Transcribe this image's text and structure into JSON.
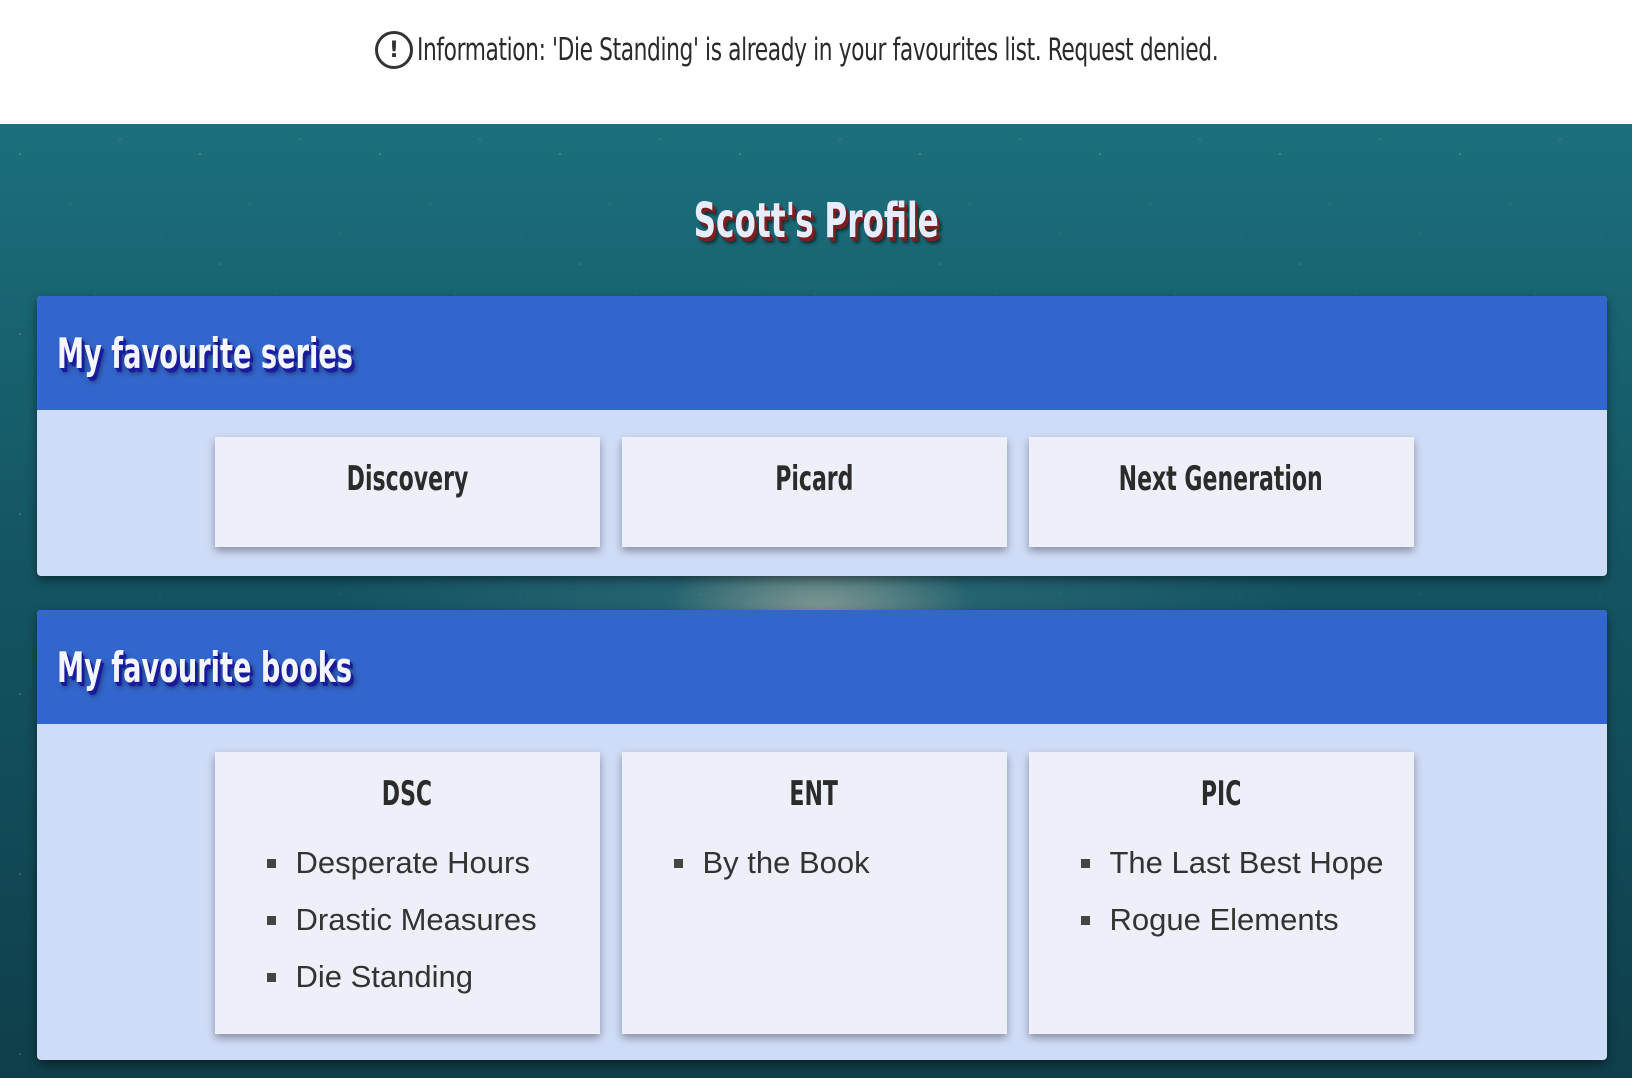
{
  "notice": {
    "icon": "exclamation-circle-icon",
    "text": "Information: 'Die Standing' is already in your favourites list. Request denied."
  },
  "profile": {
    "title": "Scott's Profile"
  },
  "series_panel": {
    "title": "My favourite series",
    "items": [
      {
        "label": "Discovery"
      },
      {
        "label": "Picard"
      },
      {
        "label": "Next Generation"
      }
    ]
  },
  "books_panel": {
    "title": "My favourite books",
    "groups": [
      {
        "title": "DSC",
        "books": [
          "Desperate Hours",
          "Drastic Measures",
          "Die Standing"
        ]
      },
      {
        "title": "ENT",
        "books": [
          "By the Book"
        ]
      },
      {
        "title": "PIC",
        "books": [
          "The Last Best Hope",
          "Rogue Elements"
        ]
      }
    ]
  },
  "colors": {
    "panel_header": "#3366cc",
    "panel_body": "#cfdcf7",
    "card": "#eef0f9"
  }
}
